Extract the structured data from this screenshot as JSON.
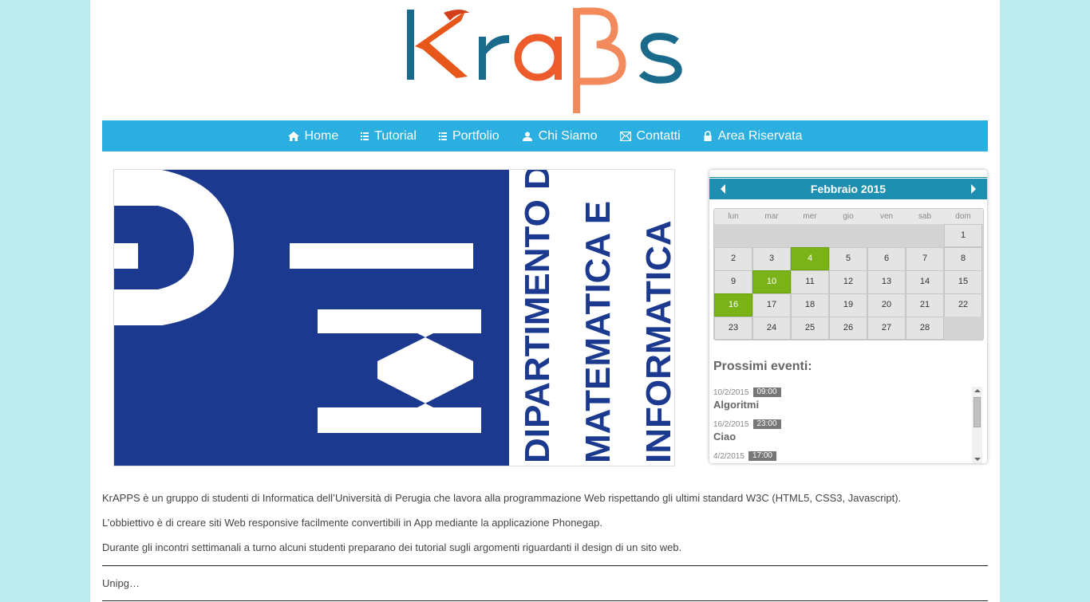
{
  "logo": {
    "text": "KraBs",
    "icon": "krabs-logo"
  },
  "nav": {
    "items": [
      {
        "label": "Home",
        "icon": "home-icon"
      },
      {
        "label": "Tutorial",
        "icon": "list-icon"
      },
      {
        "label": "Portfolio",
        "icon": "list-icon"
      },
      {
        "label": "Chi Siamo",
        "icon": "user-icon"
      },
      {
        "label": "Contatti",
        "icon": "mail-icon"
      },
      {
        "label": "Area Riservata",
        "icon": "lock-icon"
      }
    ]
  },
  "banner": {
    "lines": [
      "DIPARTIMENTO DI",
      "MATEMATICA E",
      "INFORMATICA"
    ],
    "colors": {
      "blue": "#1b3a8f",
      "white": "#ffffff"
    }
  },
  "calendar": {
    "month_label": "Febbraio 2015",
    "weekdays": [
      "lun",
      "mar",
      "mer",
      "gio",
      "ven",
      "sab",
      "dom"
    ],
    "weeks": [
      [
        "",
        "",
        "",
        "",
        "",
        "",
        "1"
      ],
      [
        "2",
        "3",
        "4",
        "5",
        "6",
        "7",
        "8"
      ],
      [
        "9",
        "10",
        "11",
        "12",
        "13",
        "14",
        "15"
      ],
      [
        "16",
        "17",
        "18",
        "19",
        "20",
        "21",
        "22"
      ],
      [
        "23",
        "24",
        "25",
        "26",
        "27",
        "28",
        ""
      ]
    ],
    "event_days": [
      "4",
      "10",
      "16"
    ],
    "colors": {
      "header": "#1f8fb1",
      "event": "#7ab317"
    }
  },
  "events": {
    "title": "Prossimi eventi:",
    "items": [
      {
        "date": "10/2/2015",
        "time": "09:00",
        "name": "Algoritmi"
      },
      {
        "date": "16/2/2015",
        "time": "23:00",
        "name": "Ciao"
      },
      {
        "date": "4/2/2015",
        "time": "17:00",
        "name": ""
      }
    ]
  },
  "content": {
    "paragraphs": [
      "KrAPPS è un gruppo di studenti di Informatica dell’Università di Perugia che lavora alla programmazione Web rispettando gli ultimi standard W3C (HTML5, CSS3, Javascript).",
      "L’obbiettivo è di creare siti Web responsive facilmente convertibili in App mediante la applicazione Phonegap.",
      "Durante gli incontri settimanali a turno alcuni studenti preparano dei tutorial sugli argomenti riguardanti il design di un sito web."
    ],
    "footer_text": "Unipg…"
  }
}
